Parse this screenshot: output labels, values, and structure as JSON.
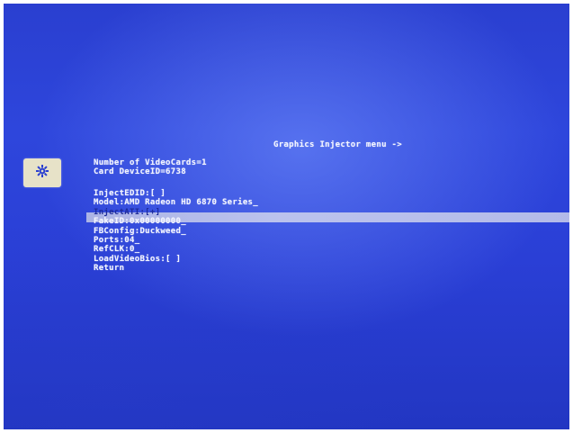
{
  "menu": {
    "title": "Graphics Injector menu ->"
  },
  "info": {
    "video_cards": "Number of VideoCards=1",
    "device_id": "Card DeviceID=6738"
  },
  "icon": "gear-icon",
  "items": [
    {
      "label": "InjectEDID:[ ]"
    },
    {
      "label": "Model:AMD Radeon HD 6870 Series_"
    },
    {
      "label": "InjectATI:[+]"
    },
    {
      "label": "FakeID:0x00000000_"
    },
    {
      "label": "FBConfig:Duckweed_"
    },
    {
      "label": "Ports:04_"
    },
    {
      "label": "RefCLK:0_"
    },
    {
      "label": "LoadVideoBios:[ ]"
    },
    {
      "label": "Return"
    }
  ],
  "selected_index": 2,
  "colors": {
    "background": "#2a3fd0",
    "text": "#f2f4ff",
    "highlight": "#c5cbee",
    "icon_box": "#e7e2c8"
  }
}
